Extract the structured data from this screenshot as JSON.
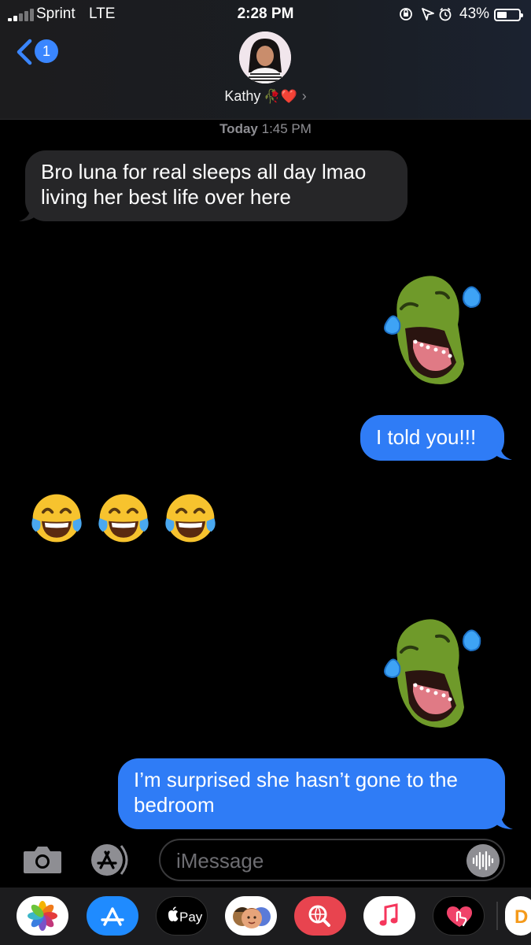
{
  "status_bar": {
    "carrier": "Sprint",
    "network": "LTE",
    "time": "2:28 PM",
    "battery_percent": "43%"
  },
  "header": {
    "back_badge": "1",
    "contact_name": "Kathy",
    "contact_emoji": "🥀❤️",
    "chevron": "›"
  },
  "conversation": {
    "timestamp_day": "Today",
    "timestamp_time": "1:45 PM",
    "messages": [
      {
        "direction": "incoming",
        "type": "text",
        "text": "Bro luna for real sleeps all day lmao living her best life over here"
      },
      {
        "direction": "outgoing",
        "type": "animoji",
        "icon": "trex-crying-laughing-icon"
      },
      {
        "direction": "outgoing",
        "type": "text",
        "text": "I told you!!!"
      },
      {
        "direction": "incoming",
        "type": "emoji",
        "icon": "face-with-tears-of-joy-icon",
        "count": 3
      },
      {
        "direction": "outgoing",
        "type": "animoji",
        "icon": "trex-crying-laughing-icon"
      },
      {
        "direction": "outgoing",
        "type": "text",
        "text": "I’m surprised she hasn’t gone to the bedroom"
      }
    ]
  },
  "input_bar": {
    "placeholder": "iMessage",
    "camera_icon": "camera-icon",
    "apps_icon": "app-store-icon",
    "voice_icon": "audio-waveform-icon"
  },
  "app_drawer": {
    "apps": [
      {
        "name": "Photos",
        "icon": "photos-icon"
      },
      {
        "name": "App Store",
        "icon": "app-store-icon"
      },
      {
        "name": "Apple Pay",
        "icon": "apple-pay-icon",
        "label": "Pay"
      },
      {
        "name": "Memoji",
        "icon": "memoji-icon"
      },
      {
        "name": "Images",
        "icon": "globe-search-icon"
      },
      {
        "name": "Music",
        "icon": "music-note-icon"
      },
      {
        "name": "Digital Touch",
        "icon": "heart-touch-icon"
      },
      {
        "name": "More",
        "icon": "more-app-icon",
        "label": "D"
      }
    ]
  },
  "colors": {
    "outgoing_bubble": "#2f7cf6",
    "incoming_bubble": "#262628",
    "background": "#000000",
    "accent": "#3a86ff"
  }
}
